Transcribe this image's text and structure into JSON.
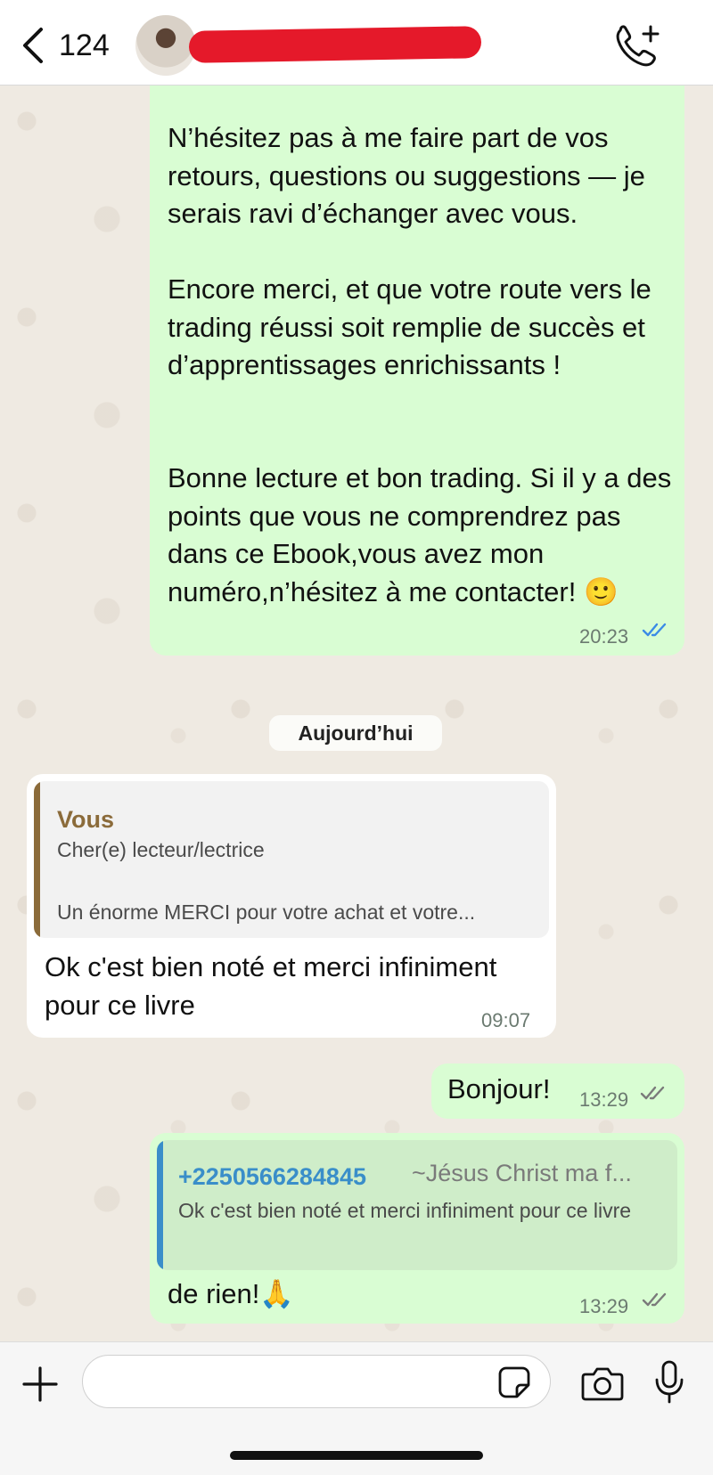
{
  "header": {
    "back_count": "124",
    "contact_name": ""
  },
  "messages": {
    "m1": {
      "paragraphs": [
        "N’hésitez pas à me faire part de vos retours, questions ou suggestions — je serais ravi d’échanger avec vous.",
        "Encore merci, et que votre route vers le trading réussi soit remplie de succès et d’apprentissages enrichissants !",
        "Bonne lecture et bon trading. Si il y a des points que vous ne comprendrez pas dans ce Ebook,vous avez mon numéro,n’hésitez à me contacter! 🙂"
      ],
      "time": "20:23"
    },
    "date_separator": "Aujourd’hui",
    "m2": {
      "quote_author": "Vous",
      "quote_line1": "Cher(e) lecteur/lectrice",
      "quote_line2": "Un énorme MERCI pour votre achat et votre...",
      "text": "Ok c'est bien noté et merci infiniment pour ce livre",
      "time": "09:07"
    },
    "m3": {
      "text": "Bonjour!",
      "time": "13:29"
    },
    "m4": {
      "quote_author": "+2250566284845",
      "quote_author_alias": "~Jésus Christ ma f...",
      "quote_text": "Ok c'est bien noté et merci infiniment pour ce livre",
      "text": "de rien!🙏",
      "time": "13:29"
    }
  },
  "input": {
    "value": "",
    "placeholder": ""
  },
  "icons": {
    "back": "chevron-left-icon",
    "call_add": "phone-plus-icon",
    "plus": "plus-icon",
    "sticker": "sticker-icon",
    "camera": "camera-icon",
    "mic": "microphone-icon",
    "read_ticks": "double-check-icon"
  },
  "colors": {
    "outgoing_bubble": "#d9fdd3",
    "incoming_bubble": "#ffffff",
    "read_ticks_blue": "#3b8be6",
    "delivered_ticks_grey": "#7a7a7a",
    "quote_bar_self": "#8b6b3a",
    "quote_bar_other": "#3a8ec9",
    "redaction": "#e5192a"
  }
}
